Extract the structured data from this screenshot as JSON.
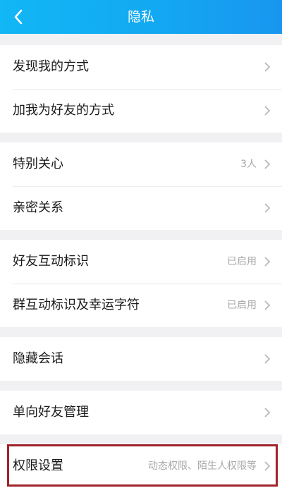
{
  "header": {
    "title": "隐私",
    "back_icon": "chevron-left-icon"
  },
  "groups": [
    {
      "items": [
        {
          "label": "发现我的方式",
          "value": ""
        },
        {
          "label": "加我为好友的方式",
          "value": ""
        }
      ]
    },
    {
      "items": [
        {
          "label": "特别关心",
          "value": "3人"
        },
        {
          "label": "亲密关系",
          "value": ""
        }
      ]
    },
    {
      "items": [
        {
          "label": "好友互动标识",
          "value": "已启用"
        },
        {
          "label": "群互动标识及幸运字符",
          "value": "已启用"
        }
      ]
    },
    {
      "items": [
        {
          "label": "隐藏会话",
          "value": ""
        }
      ]
    },
    {
      "items": [
        {
          "label": "单向好友管理",
          "value": ""
        }
      ]
    },
    {
      "items": [
        {
          "label": "权限设置",
          "value": "动态权限、陌生人权限等"
        }
      ]
    }
  ],
  "colors": {
    "header_start": "#12b7f5",
    "header_end": "#1896ef",
    "highlight": "#a0222a",
    "background": "#f1f1f4"
  }
}
